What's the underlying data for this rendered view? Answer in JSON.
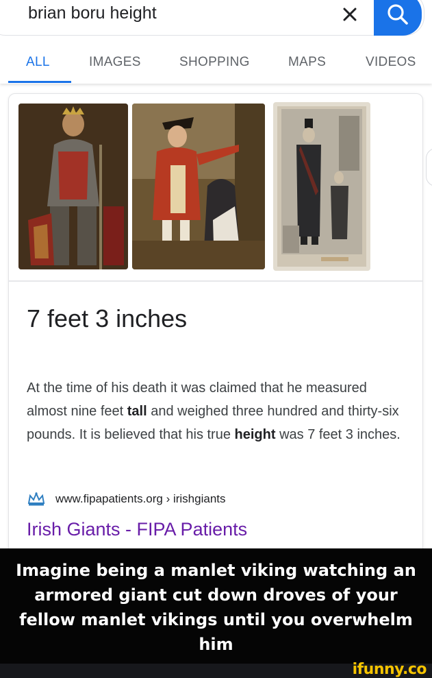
{
  "search": {
    "query": "brian boru height",
    "clear_icon": "close-icon",
    "search_icon": "search-icon"
  },
  "tabs": [
    {
      "label": "ALL",
      "active": true
    },
    {
      "label": "IMAGES",
      "active": false
    },
    {
      "label": "SHOPPING",
      "active": false
    },
    {
      "label": "MAPS",
      "active": false
    },
    {
      "label": "VIDEOS",
      "active": false
    }
  ],
  "result": {
    "answer": "7 feet 3 inches",
    "snippet_parts": [
      "At the time of his death it was claimed that he measured almost nine feet ",
      "tall",
      " and weighed three hundred and thirty-six pounds. It is believed that his true ",
      "height",
      " was 7 feet 3 inches."
    ],
    "source_url": "www.fipapatients.org › irishgiants",
    "link_title": "Irish Giants - FIPA Patients",
    "source_icon": "crown-icon"
  },
  "caption": {
    "text": "Imagine being a manlet viking watching an armored giant cut down droves of your fellow manlet vikings until you overwhelm him"
  },
  "watermark": {
    "text": "ifunny.co"
  },
  "colors": {
    "accent": "#1a73e8",
    "link_visited": "#681da8",
    "watermark": "#f6c400"
  }
}
